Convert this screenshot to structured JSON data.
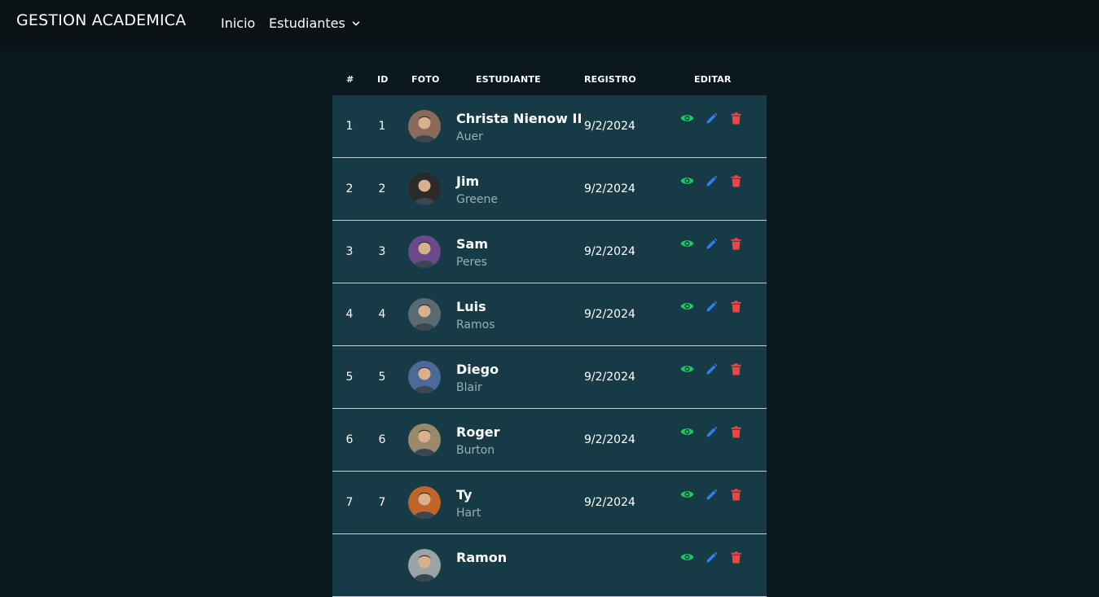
{
  "navbar": {
    "brand": "GESTION ACADEMICA",
    "links": [
      {
        "label": "Inicio"
      },
      {
        "label": "Estudiantes"
      }
    ]
  },
  "table": {
    "headers": [
      "#",
      "ID",
      "FOTO",
      "ESTUDIANTE",
      "REGISTRO",
      "EDITAR"
    ],
    "rows": [
      {
        "num": "1",
        "id": "1",
        "first": "Christa Nienow II",
        "last": "Auer",
        "date": "9/2/2024",
        "avatar_color": "#8a6a5a"
      },
      {
        "num": "2",
        "id": "2",
        "first": "Jim",
        "last": "Greene",
        "date": "9/2/2024",
        "avatar_color": "#2a2a2a"
      },
      {
        "num": "3",
        "id": "3",
        "first": "Sam",
        "last": "Peres",
        "date": "9/2/2024",
        "avatar_color": "#6a4a8a"
      },
      {
        "num": "4",
        "id": "4",
        "first": "Luis",
        "last": "Ramos",
        "date": "9/2/2024",
        "avatar_color": "#5a6a72"
      },
      {
        "num": "5",
        "id": "5",
        "first": "Diego",
        "last": "Blair",
        "date": "9/2/2024",
        "avatar_color": "#4a6a9a"
      },
      {
        "num": "6",
        "id": "6",
        "first": "Roger",
        "last": "Burton",
        "date": "9/2/2024",
        "avatar_color": "#9a8a6a"
      },
      {
        "num": "7",
        "id": "7",
        "first": "Ty",
        "last": "Hart",
        "date": "9/2/2024",
        "avatar_color": "#c0642a"
      },
      {
        "num": "",
        "id": "",
        "first": "Ramon",
        "last": "",
        "date": "",
        "avatar_color": "#9aa3a6"
      }
    ]
  },
  "icons": {
    "view": "eye-icon",
    "edit": "pencil-icon",
    "delete": "trash-icon",
    "dropdown": "chevron-down-icon"
  },
  "colors": {
    "view": "#22c55e",
    "edit": "#2f80ed",
    "delete": "#ef4444",
    "row_bg": "#163b46",
    "page_bg": "#0a181d",
    "navbar_bg": "#0b1215"
  }
}
